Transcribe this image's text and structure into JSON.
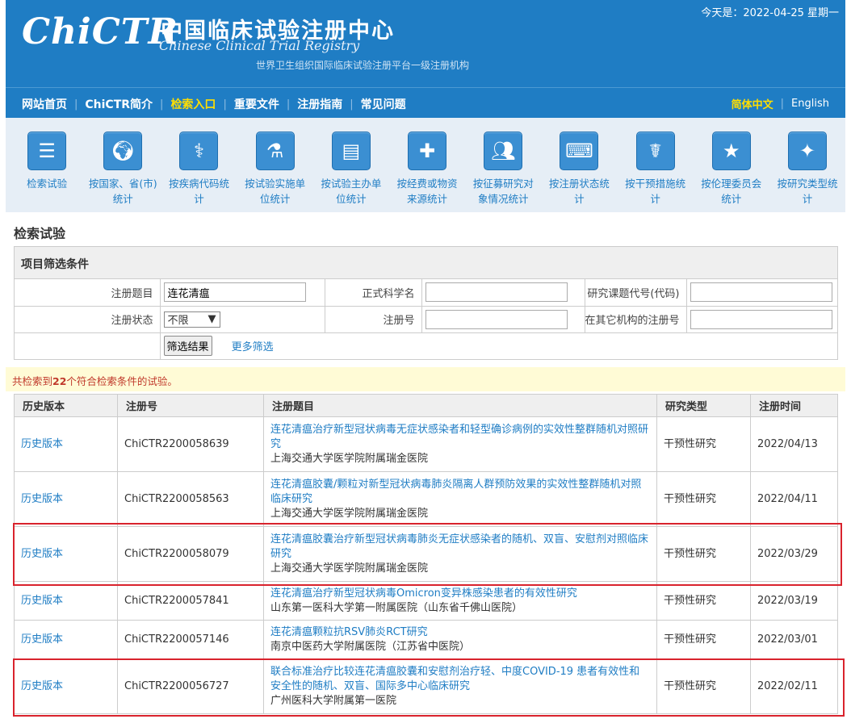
{
  "header": {
    "logo_text": "ChiCTR",
    "cn_title": "中国临床试验注册中心",
    "en_title": "Chinese Clinical Trial Registry",
    "who_text": "世界卫生组织国际临床试验注册平台一级注册机构",
    "today": "今天是：2022-04-25 星期一"
  },
  "nav": {
    "items": [
      {
        "label": "网站首页"
      },
      {
        "label": "ChiCTR简介"
      },
      {
        "label": "检索入口"
      },
      {
        "label": "重要文件"
      },
      {
        "label": "注册指南"
      },
      {
        "label": "常见问题"
      }
    ],
    "active_index": 2,
    "langs": [
      {
        "label": "简体中文"
      },
      {
        "label": "English"
      }
    ]
  },
  "icon_menu": [
    {
      "label": "检索试验",
      "icon": "list-icon"
    },
    {
      "label": "按国家、省(市)统计",
      "icon": "world-map-icon"
    },
    {
      "label": "按疾病代码统计",
      "icon": "dna-icon"
    },
    {
      "label": "按试验实施单位统计",
      "icon": "flask-icon"
    },
    {
      "label": "按试验主办单位统计",
      "icon": "clipboard-icon"
    },
    {
      "label": "按经费或物资来源统计",
      "icon": "medkit-icon"
    },
    {
      "label": "按征募研究对象情况统计",
      "icon": "people-icon"
    },
    {
      "label": "按注册状态统计",
      "icon": "keyboard-icon"
    },
    {
      "label": "按干预措施统计",
      "icon": "doctor-icon"
    },
    {
      "label": "按伦理委员会统计",
      "icon": "star-icon"
    },
    {
      "label": "按研究类型统计",
      "icon": "sparkle-icon"
    }
  ],
  "section_title": "检索试验",
  "filter": {
    "heading": "项目筛选条件",
    "fields": {
      "title_label": "注册题目",
      "title_value": "连花清瘟",
      "sci_title_label": "正式科学名",
      "sci_title_value": "",
      "code_label": "研究课题代号(代码)",
      "code_value": "",
      "status_label": "注册状态",
      "status_value": "不限",
      "regno_label": "注册号",
      "regno_value": "",
      "other_regno_label": "在其它机构的注册号",
      "other_regno_value": ""
    },
    "submit_label": "筛选结果",
    "more_label": "更多筛选"
  },
  "summary": {
    "prefix": "共检索到",
    "count": "22",
    "suffix": "个符合检索条件的试验。"
  },
  "table": {
    "headers": [
      "历史版本",
      "注册号",
      "注册题目",
      "研究类型",
      "注册时间"
    ],
    "rows": [
      {
        "history": "历史版本",
        "regno": "ChiCTR2200058639",
        "title": "连花清瘟治疗新型冠状病毒无症状感染者和轻型确诊病例的实效性整群随机对照研究",
        "institution": "上海交通大学医学院附属瑞金医院",
        "type": "干预性研究",
        "date": "2022/04/13"
      },
      {
        "history": "历史版本",
        "regno": "ChiCTR2200058563",
        "title": "连花清瘟胶囊/颗粒对新型冠状病毒肺炎隔离人群预防效果的实效性整群随机对照临床研究",
        "institution": "上海交通大学医学院附属瑞金医院",
        "type": "干预性研究",
        "date": "2022/04/11"
      },
      {
        "history": "历史版本",
        "regno": "ChiCTR2200058079",
        "title": "连花清瘟胶囊治疗新型冠状病毒肺炎无症状感染者的随机、双盲、安慰剂对照临床研究",
        "institution": "上海交通大学医学院附属瑞金医院",
        "type": "干预性研究",
        "date": "2022/03/29"
      },
      {
        "history": "历史版本",
        "regno": "ChiCTR2200057841",
        "title": "连花清瘟治疗新型冠状病毒Omicron变异株感染患者的有效性研究",
        "institution": "山东第一医科大学第一附属医院（山东省千佛山医院）",
        "type": "干预性研究",
        "date": "2022/03/19"
      },
      {
        "history": "历史版本",
        "regno": "ChiCTR2200057146",
        "title": "连花清瘟颗粒抗RSV肺炎RCT研究",
        "institution": "南京中医药大学附属医院（江苏省中医院）",
        "type": "干预性研究",
        "date": "2022/03/01"
      },
      {
        "history": "历史版本",
        "regno": "ChiCTR2200056727",
        "title": "联合标准治疗比较连花清瘟胶囊和安慰剂治疗轻、中度COVID-19 患者有效性和安全性的随机、双盲、国际多中心临床研究",
        "institution": "广州医科大学附属第一医院",
        "type": "干预性研究",
        "date": "2022/02/11"
      }
    ]
  },
  "colors": {
    "header_blue": "#1f7dc4",
    "active_nav": "#ffde00",
    "link_blue": "#1f7dc4",
    "highlight_red": "#d9232d"
  }
}
